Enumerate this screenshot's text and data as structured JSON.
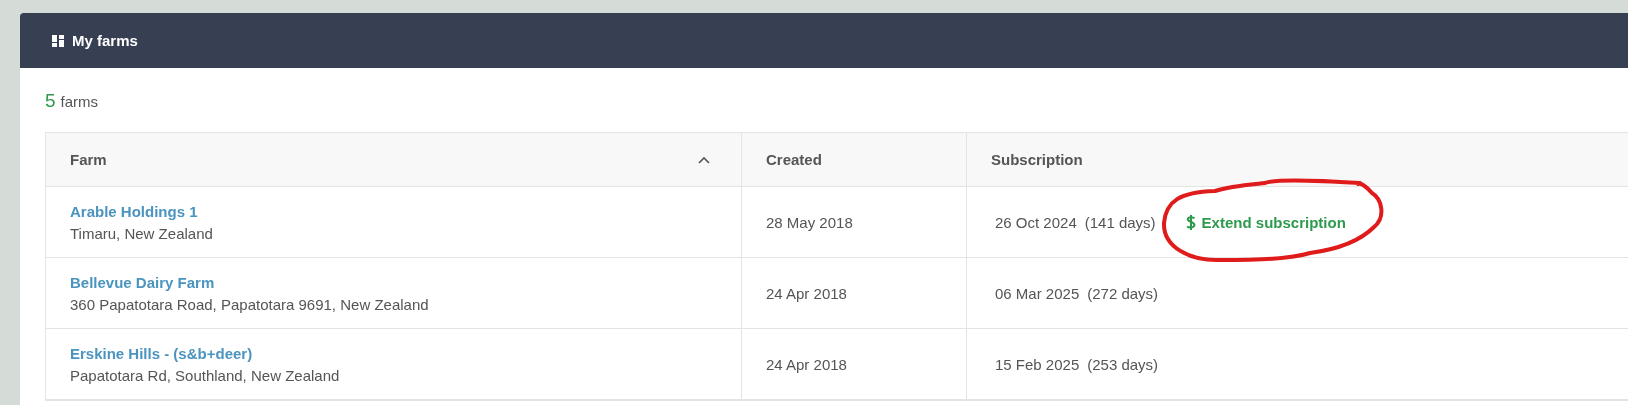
{
  "panel": {
    "title": "My farms"
  },
  "summary": {
    "count": "5",
    "unit": "farms"
  },
  "table": {
    "columns": [
      {
        "label": "Farm",
        "sorted": true
      },
      {
        "label": "Created"
      },
      {
        "label": "Subscription"
      }
    ],
    "rows": [
      {
        "name": "Arable Holdings 1",
        "address": "Timaru, New Zealand",
        "created": "28 May 2018",
        "expires": "26 Oct 2024",
        "remaining": "(141 days)",
        "action": {
          "label": "Extend subscription",
          "circled": true
        }
      },
      {
        "name": "Bellevue Dairy Farm",
        "address": "360 Papatotara Road, Papatotara 9691, New Zealand",
        "created": "24 Apr 2018",
        "expires": "06 Mar 2025",
        "remaining": "(272 days)"
      },
      {
        "name": "Erskine Hills - (s&b+deer)",
        "address": "Papatotara Rd, Southland, New Zealand",
        "created": "24 Apr 2018",
        "expires": "15 Feb 2025",
        "remaining": "(253 days)"
      }
    ]
  }
}
